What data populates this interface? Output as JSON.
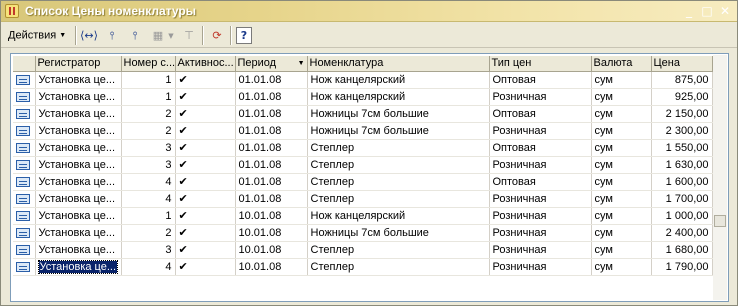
{
  "window": {
    "title": "Список Цены номенклатуры",
    "minimize": "_",
    "maximize": "□",
    "close": "✕"
  },
  "toolbar": {
    "actions_label": "Действия",
    "buttons": [
      {
        "name": "scroll-to-icon",
        "glyph": "⟨↔⟩"
      },
      {
        "name": "filter-icon",
        "glyph": "⫯"
      },
      {
        "name": "filter-edit-icon",
        "glyph": "⫯"
      },
      {
        "name": "filter-list-icon",
        "glyph": "▦"
      },
      {
        "name": "clear-filter-icon",
        "glyph": "⊤"
      },
      {
        "name": "refresh-icon",
        "glyph": "⟳"
      },
      {
        "name": "help-icon",
        "glyph": "?"
      }
    ]
  },
  "table": {
    "columns": [
      "",
      "Регистратор",
      "Номер с...",
      "Активнос...",
      "Период",
      "Номенклатура",
      "Тип цен",
      "Валюта",
      "Цена"
    ],
    "rows": [
      {
        "registrar": "Установка це...",
        "line": "1",
        "active": "✔",
        "period": "01.01.08",
        "item": "Нож канцелярский",
        "price_type": "Оптовая",
        "currency": "сум",
        "price": "875,00"
      },
      {
        "registrar": "Установка це...",
        "line": "1",
        "active": "✔",
        "period": "01.01.08",
        "item": "Нож канцелярский",
        "price_type": "Розничная",
        "currency": "сум",
        "price": "925,00"
      },
      {
        "registrar": "Установка це...",
        "line": "2",
        "active": "✔",
        "period": "01.01.08",
        "item": "Ножницы 7см большие",
        "price_type": "Оптовая",
        "currency": "сум",
        "price": "2 150,00"
      },
      {
        "registrar": "Установка це...",
        "line": "2",
        "active": "✔",
        "period": "01.01.08",
        "item": "Ножницы 7см большие",
        "price_type": "Розничная",
        "currency": "сум",
        "price": "2 300,00"
      },
      {
        "registrar": "Установка це...",
        "line": "3",
        "active": "✔",
        "period": "01.01.08",
        "item": "Степлер",
        "price_type": "Оптовая",
        "currency": "сум",
        "price": "1 550,00"
      },
      {
        "registrar": "Установка це...",
        "line": "3",
        "active": "✔",
        "period": "01.01.08",
        "item": "Степлер",
        "price_type": "Розничная",
        "currency": "сум",
        "price": "1 630,00"
      },
      {
        "registrar": "Установка це...",
        "line": "4",
        "active": "✔",
        "period": "01.01.08",
        "item": "Степлер",
        "price_type": "Оптовая",
        "currency": "сум",
        "price": "1 600,00"
      },
      {
        "registrar": "Установка це...",
        "line": "4",
        "active": "✔",
        "period": "01.01.08",
        "item": "Степлер",
        "price_type": "Розничная",
        "currency": "сум",
        "price": "1 700,00"
      },
      {
        "registrar": "Установка це...",
        "line": "1",
        "active": "✔",
        "period": "10.01.08",
        "item": "Нож канцелярский",
        "price_type": "Розничная",
        "currency": "сум",
        "price": "1 000,00"
      },
      {
        "registrar": "Установка це...",
        "line": "2",
        "active": "✔",
        "period": "10.01.08",
        "item": "Ножницы 7см большие",
        "price_type": "Розничная",
        "currency": "сум",
        "price": "2 400,00"
      },
      {
        "registrar": "Установка це...",
        "line": "3",
        "active": "✔",
        "period": "10.01.08",
        "item": "Степлер",
        "price_type": "Розничная",
        "currency": "сум",
        "price": "1 680,00"
      },
      {
        "registrar": "Установка це...",
        "line": "4",
        "active": "✔",
        "period": "10.01.08",
        "item": "Степлер",
        "price_type": "Розничная",
        "currency": "сум",
        "price": "1 790,00"
      }
    ],
    "selected_row": 11
  },
  "colors": {
    "title_gradient_start": "#d8c77a",
    "title_gradient_end": "#f7ecc0",
    "selection": "#0a246a",
    "icon_blue": "#2b5fa8"
  }
}
